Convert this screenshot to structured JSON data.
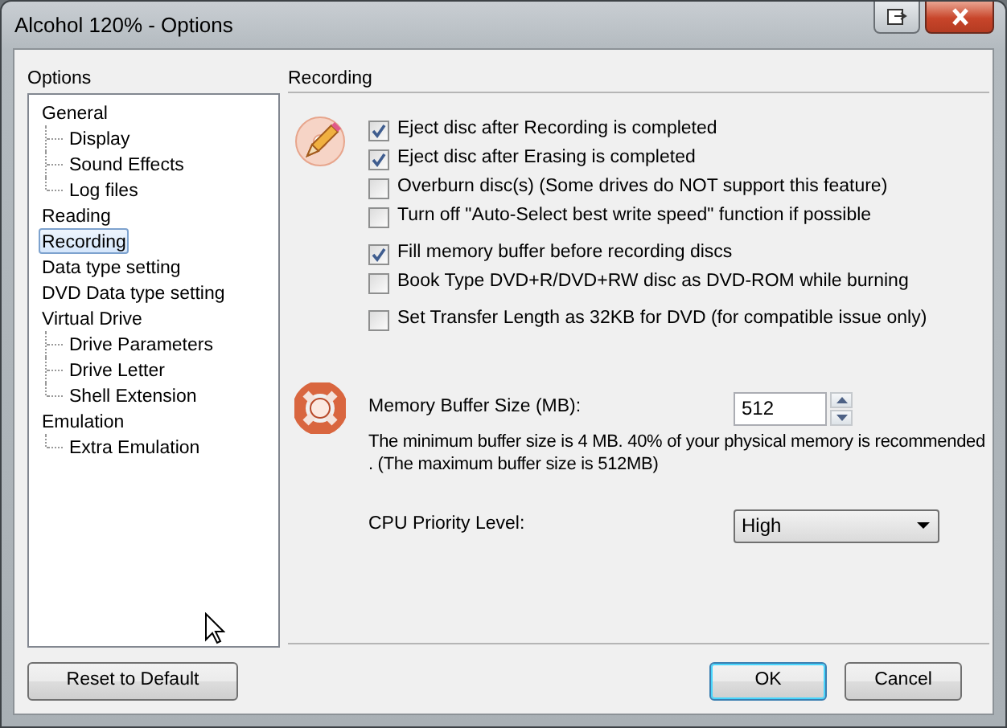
{
  "window": {
    "title": "Alcohol 120% - Options"
  },
  "sidebar": {
    "label": "Options",
    "items": [
      {
        "label": "General",
        "selected": false,
        "children": [
          {
            "label": "Display",
            "selected": false
          },
          {
            "label": "Sound Effects",
            "selected": false
          },
          {
            "label": "Log files",
            "selected": false
          }
        ]
      },
      {
        "label": "Reading",
        "selected": false
      },
      {
        "label": "Recording",
        "selected": true
      },
      {
        "label": "Data type setting",
        "selected": false
      },
      {
        "label": "DVD Data type setting",
        "selected": false
      },
      {
        "label": "Virtual Drive",
        "selected": false,
        "children": [
          {
            "label": "Drive Parameters",
            "selected": false
          },
          {
            "label": "Drive Letter",
            "selected": false
          },
          {
            "label": "Shell Extension",
            "selected": false
          }
        ]
      },
      {
        "label": "Emulation",
        "selected": false,
        "children": [
          {
            "label": "Extra Emulation",
            "selected": false
          }
        ]
      }
    ]
  },
  "panel": {
    "title": "Recording",
    "option_groups": [
      [
        {
          "label": "Eject disc after Recording is completed",
          "checked": true
        },
        {
          "label": "Eject disc after Erasing is completed",
          "checked": true
        },
        {
          "label": "Overburn disc(s) (Some drives do NOT support this feature)",
          "checked": false
        },
        {
          "label": "Turn off \"Auto-Select best write speed\" function if possible",
          "checked": false
        }
      ],
      [
        {
          "label": "Fill memory buffer before recording discs",
          "checked": true
        },
        {
          "label": "Book Type DVD+R/DVD+RW disc as DVD-ROM while burning",
          "checked": false
        }
      ],
      [
        {
          "label": "Set Transfer Length as 32KB for DVD (for compatible issue only)",
          "checked": false
        }
      ]
    ],
    "memory_buffer": {
      "label": "Memory Buffer Size (MB):",
      "value": "512",
      "note": "The minimum buffer size is 4 MB. 40% of your physical memory is recommended . (The maximum buffer size is 512MB)"
    },
    "cpu_priority": {
      "label": "CPU Priority Level:",
      "value": "High"
    }
  },
  "buttons": {
    "reset": "Reset to Default",
    "ok": "OK",
    "cancel": "Cancel"
  }
}
